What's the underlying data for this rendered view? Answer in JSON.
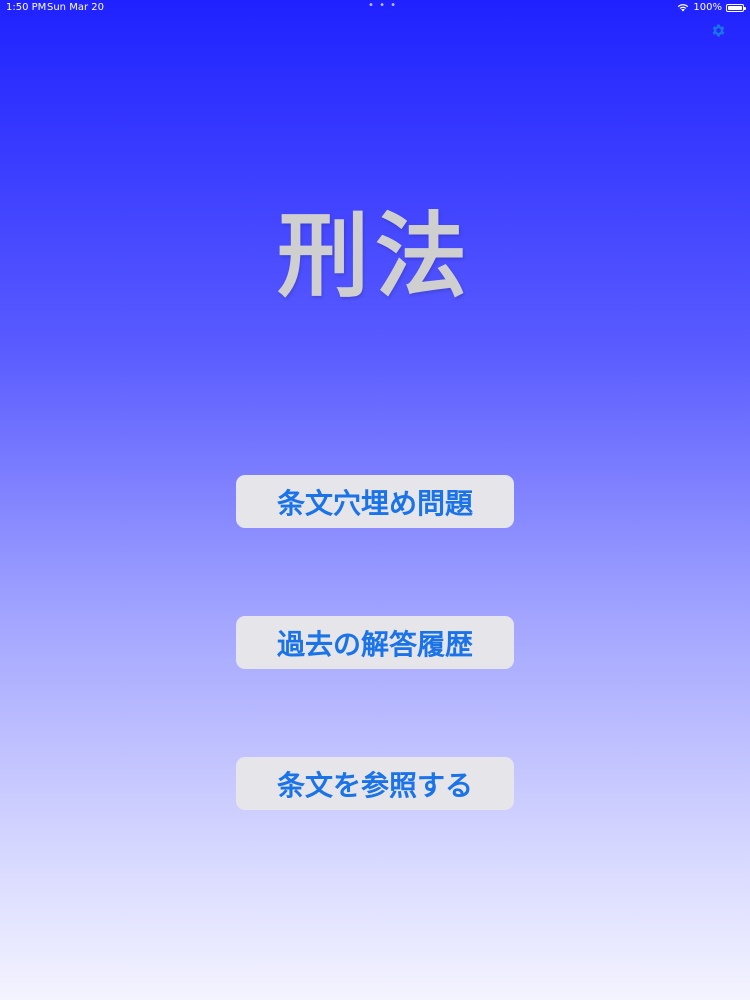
{
  "status_bar": {
    "time": "1:50 PM",
    "date": "Sun Mar 20",
    "multitask_dots": "• • •",
    "battery_percent": "100%",
    "battery_level": 1.0
  },
  "settings": {
    "icon": "gear-icon",
    "color": "#1a73e8"
  },
  "title": "刑法",
  "menu": {
    "fill_blank_quiz_label": "条文穴埋め問題",
    "answer_history_label": "過去の解答履歴",
    "browse_articles_label": "条文を参照する"
  },
  "colors": {
    "gradient_top": "#1f22ff",
    "gradient_bottom": "#f4f4ff",
    "button_background": "#e5e5ea",
    "button_text": "#1a73e8",
    "title_text": "#cfcfcf"
  }
}
